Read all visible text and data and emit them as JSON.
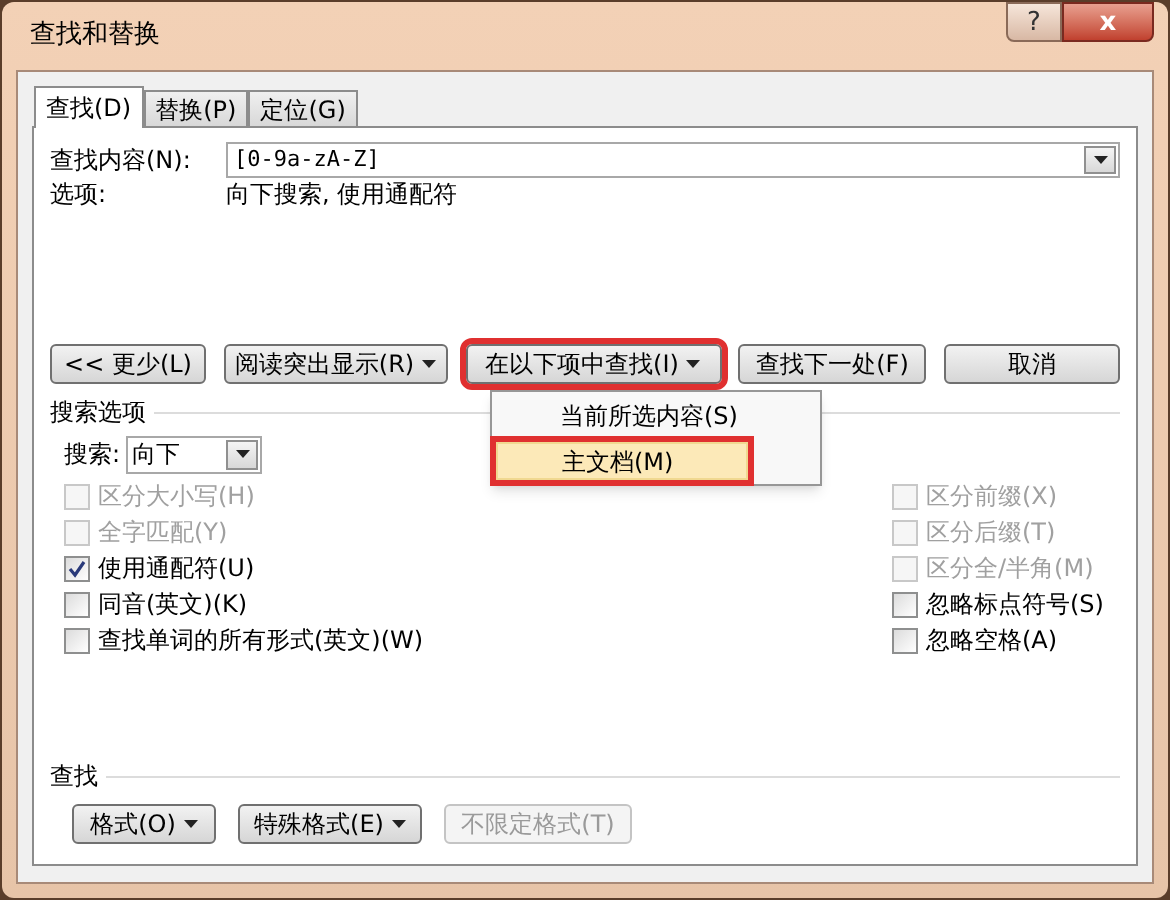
{
  "window": {
    "title": "查找和替换",
    "help": "?",
    "close": "x"
  },
  "tabs": [
    {
      "label": "查找(D)",
      "selected": true
    },
    {
      "label": "替换(P)",
      "selected": false
    },
    {
      "label": "定位(G)",
      "selected": false
    }
  ],
  "find": {
    "label": "查找内容(N):",
    "value": "[0-9a-zA-Z]"
  },
  "options": {
    "label": "选项:",
    "value": "向下搜索, 使用通配符"
  },
  "buttons": [
    {
      "label": "<< 更少(L)",
      "dropdown": false,
      "disabled": false,
      "highlighted": false
    },
    {
      "label": "阅读突出显示(R)",
      "dropdown": true,
      "disabled": false,
      "highlighted": false
    },
    {
      "label": "在以下项中查找(I)",
      "dropdown": true,
      "disabled": false,
      "highlighted": true
    },
    {
      "label": "查找下一处(F)",
      "dropdown": false,
      "disabled": false,
      "highlighted": false
    },
    {
      "label": "取消",
      "dropdown": false,
      "disabled": false,
      "highlighted": false
    }
  ],
  "menu": [
    {
      "label": "当前所选内容(S)",
      "selected": false,
      "highlighted": false
    },
    {
      "label": "主文档(M)",
      "selected": true,
      "highlighted": true
    }
  ],
  "search_options": {
    "title": "搜索选项",
    "direction_label": "搜索:",
    "direction": "向下"
  },
  "left_checks": [
    {
      "label": "区分大小写(H)",
      "checked": false,
      "disabled": true
    },
    {
      "label": "全字匹配(Y)",
      "checked": false,
      "disabled": true
    },
    {
      "label": "使用通配符(U)",
      "checked": true,
      "disabled": false
    },
    {
      "label": "同音(英文)(K)",
      "checked": false,
      "disabled": false
    },
    {
      "label": "查找单词的所有形式(英文)(W)",
      "checked": false,
      "disabled": false
    }
  ],
  "right_checks": [
    {
      "label": "区分前缀(X)",
      "checked": false,
      "disabled": true
    },
    {
      "label": "区分后缀(T)",
      "checked": false,
      "disabled": true
    },
    {
      "label": "区分全/半角(M)",
      "checked": false,
      "disabled": true
    },
    {
      "label": "忽略标点符号(S)",
      "checked": false,
      "disabled": false
    },
    {
      "label": "忽略空格(A)",
      "checked": false,
      "disabled": false
    }
  ],
  "find_section": {
    "title": "查找",
    "buttons": [
      {
        "label": "格式(O)",
        "dropdown": true,
        "disabled": false
      },
      {
        "label": "特殊格式(E)",
        "dropdown": true,
        "disabled": false
      },
      {
        "label": "不限定格式(T)",
        "dropdown": false,
        "disabled": true
      }
    ]
  }
}
